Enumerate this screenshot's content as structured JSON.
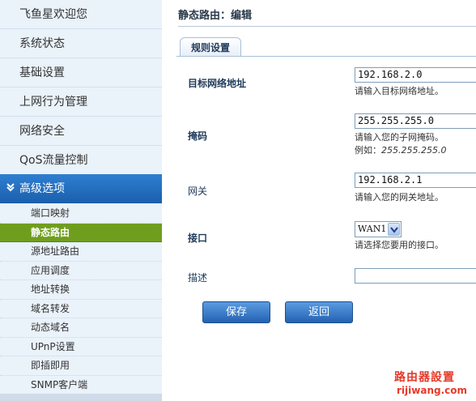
{
  "sidebar": {
    "top_items": [
      {
        "label": "飞鱼星欢迎您"
      },
      {
        "label": "系统状态"
      },
      {
        "label": "基础设置"
      },
      {
        "label": "上网行为管理"
      },
      {
        "label": "网络安全"
      },
      {
        "label": "QoS流量控制"
      }
    ],
    "advanced": {
      "label": "高级选项",
      "icon": "double-chevron-down-icon"
    },
    "sub_items": [
      {
        "label": "端口映射"
      },
      {
        "label": "静态路由",
        "active": true
      },
      {
        "label": "源地址路由"
      },
      {
        "label": "应用调度"
      },
      {
        "label": "地址转换"
      },
      {
        "label": "域名转发"
      },
      {
        "label": "动态域名"
      },
      {
        "label": "UPnP设置"
      },
      {
        "label": "即插即用"
      },
      {
        "label": "SNMP客户端"
      }
    ]
  },
  "main": {
    "title": "静态路由：编辑",
    "tab": "规则设置",
    "fields": {
      "dest": {
        "label": "目标网络地址",
        "value": "192.168.2.0",
        "hint": "请输入目标网络地址。"
      },
      "mask": {
        "label": "掩码",
        "value": "255.255.255.0",
        "hint": "请输入您的子网掩码。",
        "example_prefix": "例如：",
        "example_value": "255.255.255.0"
      },
      "gateway": {
        "label": "网关",
        "value": "192.168.2.1",
        "hint": "请输入您的网关地址。"
      },
      "iface": {
        "label": "接口",
        "value": "WAN1",
        "hint": "请选择您要用的接口。"
      },
      "desc": {
        "label": "描述",
        "value": ""
      }
    },
    "buttons": {
      "save": "保存",
      "back": "返回"
    }
  },
  "watermark": {
    "line1": "路由器設置",
    "line2": "rijiwang.com"
  },
  "colors": {
    "accent_blue": "#1a5fad",
    "active_green": "#6f9e1e",
    "watermark_red": "#e53a2a"
  }
}
